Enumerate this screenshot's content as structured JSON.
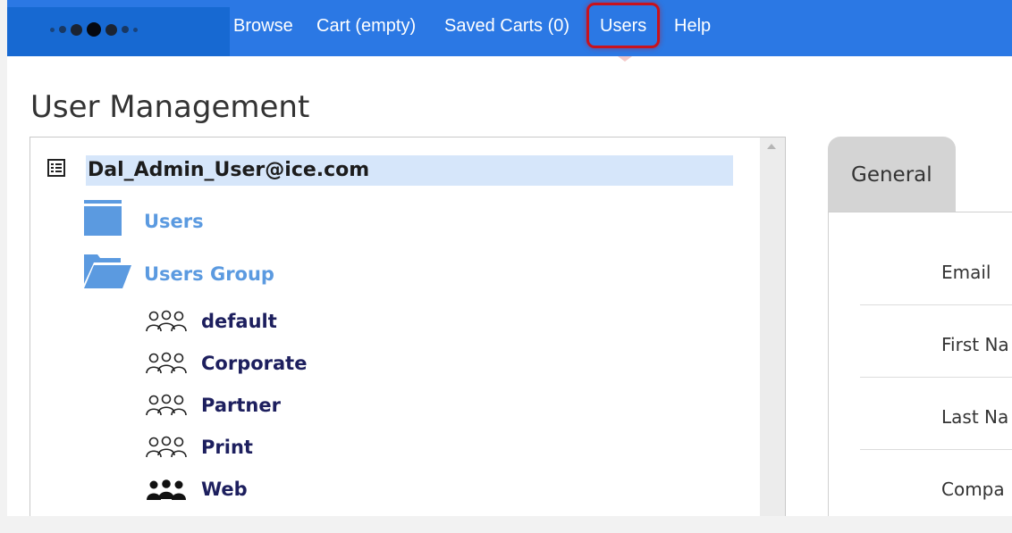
{
  "nav": {
    "items": [
      {
        "label": "Browse"
      },
      {
        "label": "Cart (empty)"
      },
      {
        "label": "Saved Carts (0)"
      },
      {
        "label": "Users"
      },
      {
        "label": "Help"
      }
    ],
    "active": "Users",
    "brand_color": "#2b78e4",
    "highlight_color": "#c8121c"
  },
  "page": {
    "title": "User Management"
  },
  "tree": {
    "root": {
      "label": "Dal_Admin_User@ice.com",
      "icon": "list-icon"
    },
    "folders": [
      {
        "label": "Users",
        "icon": "folder-closed-icon"
      },
      {
        "label": "Users Group",
        "icon": "folder-open-icon"
      }
    ],
    "groups": [
      {
        "label": "default",
        "icon": "group-outline-icon"
      },
      {
        "label": "Corporate",
        "icon": "group-outline-icon"
      },
      {
        "label": "Partner",
        "icon": "group-outline-icon"
      },
      {
        "label": "Print",
        "icon": "group-outline-icon"
      },
      {
        "label": "Web",
        "icon": "group-filled-icon"
      }
    ]
  },
  "details": {
    "tab": "General",
    "fields": [
      {
        "label": "Email"
      },
      {
        "label": "First Na"
      },
      {
        "label": "Last Na"
      },
      {
        "label": "Compa"
      }
    ]
  }
}
